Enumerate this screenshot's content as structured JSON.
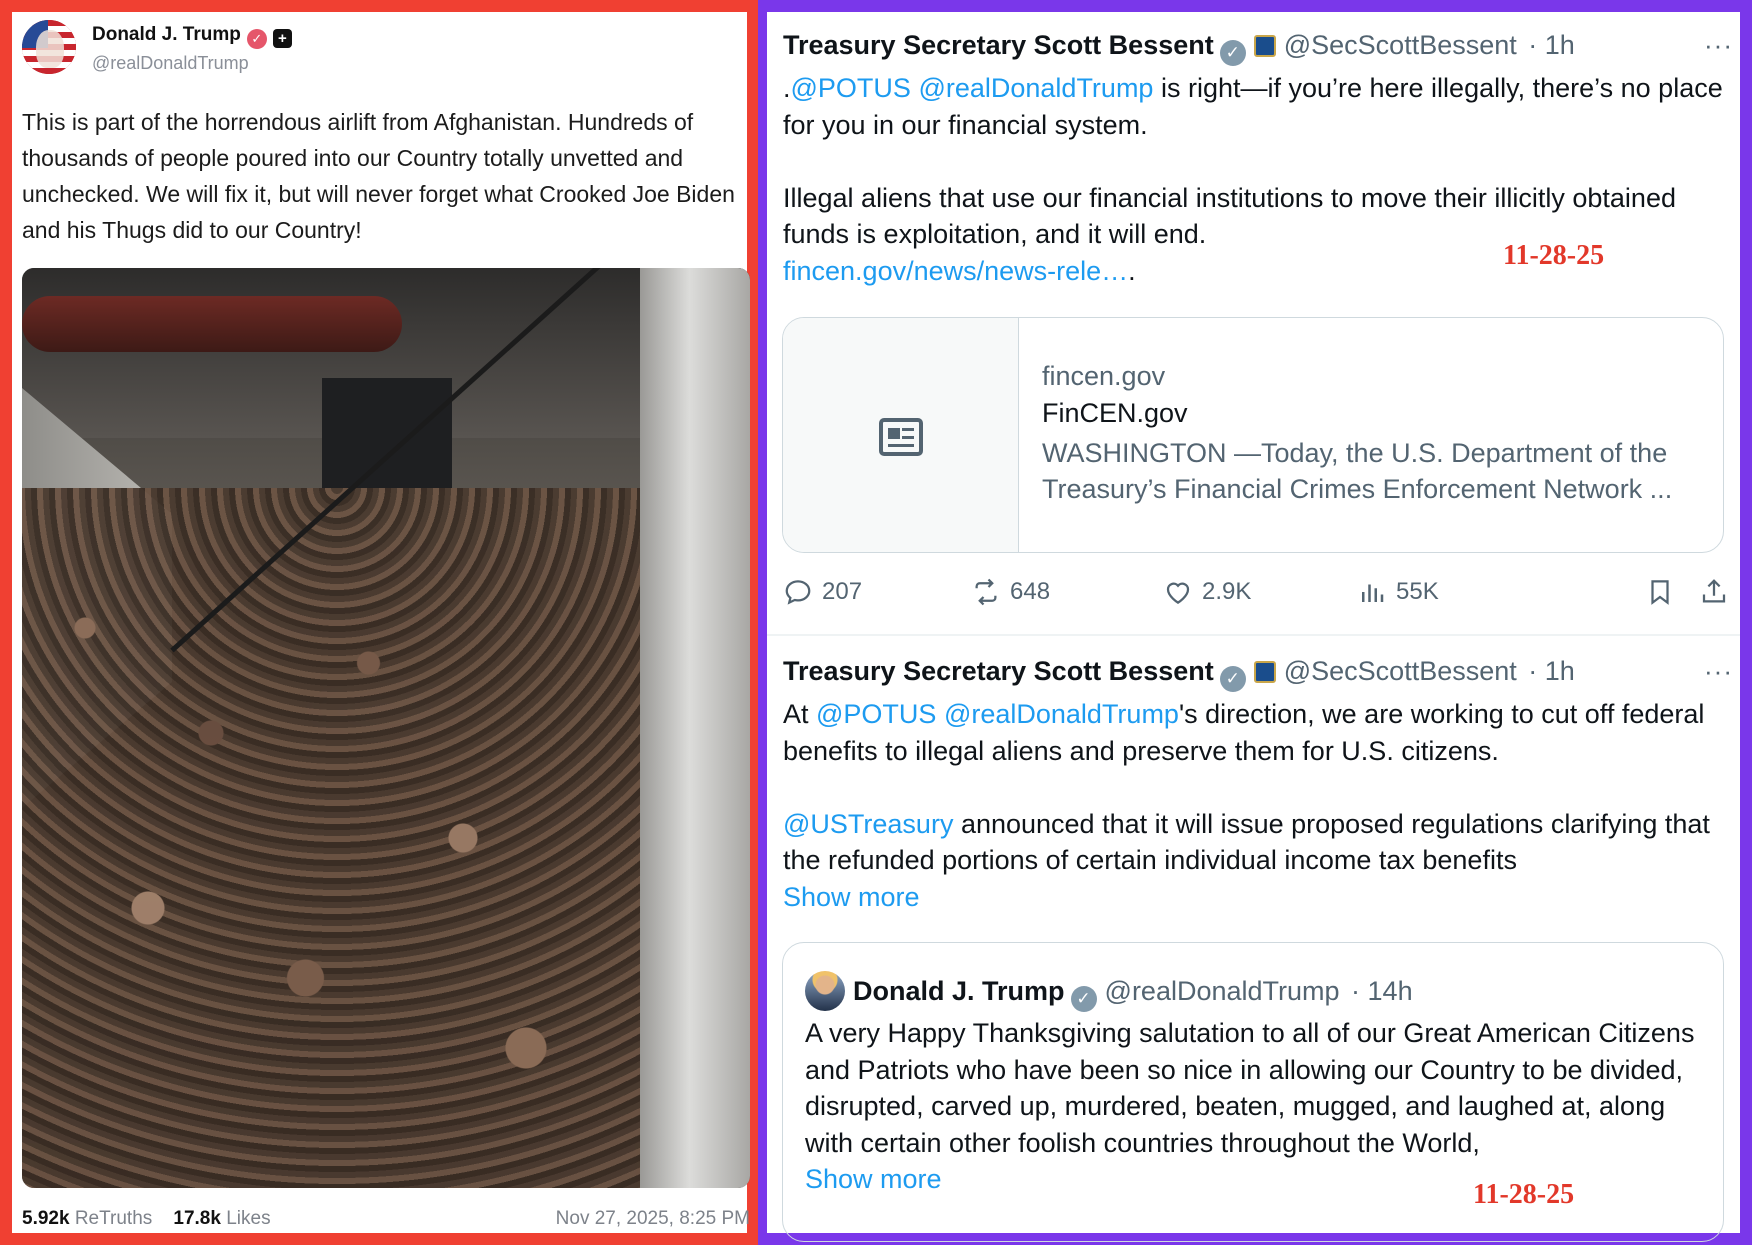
{
  "left": {
    "author_name": "Donald J. Trump",
    "author_handle": "@realDonaldTrump",
    "post_text": "This is part of the horrendous airlift from Afghanistan. Hundreds of thousands of people poured into our Country totally unvetted and unchecked. We will fix it, but will never forget what Crooked Joe Biden and his Thugs did to our Country!",
    "retruths_count": "5.92k",
    "retruths_label": "ReTruths",
    "likes_count": "17.8k",
    "likes_label": "Likes",
    "timestamp": "Nov 27, 2025, 8:25 PM",
    "border_color": "#f04032"
  },
  "right": {
    "border_color": "#7a37ea",
    "tweet1": {
      "author_name": "Treasury Secretary Scott Bessent",
      "author_handle": "@SecScottBessent",
      "time": "· 1h",
      "more": "···",
      "body_pre": ".",
      "mention1": "@POTUS",
      "mention2": "@realDonaldTrump",
      "body_line1": " is right—if you’re here illegally, there’s no place for you in our financial system.",
      "body_para2": "Illegal aliens that use our financial institutions to move their illicitly obtained funds is exploitation, and it will end.",
      "link_text": "fincen.gov/news/news-rele…",
      "link_suffix": ".",
      "stamp": "11-28-25",
      "card": {
        "domain": "fincen.gov",
        "title": "FinCEN.gov",
        "description": "WASHINGTON —Today, the U.S. Department of the Treasury’s Financial Crimes Enforcement Network ..."
      },
      "actions": {
        "replies": "207",
        "reposts": "648",
        "likes": "2.9K",
        "views": "55K"
      }
    },
    "tweet2": {
      "author_name": "Treasury Secretary Scott Bessent",
      "author_handle": "@SecScottBessent",
      "time": "· 1h",
      "more": "···",
      "body_pre": "At ",
      "mention1": "@POTUS",
      "mention2": "@realDonaldTrump",
      "body_line1": "'s direction, we are working to cut off federal benefits to illegal aliens and preserve them for U.S. citizens.",
      "mention3": "@USTreasury",
      "body_para2": " announced that it will issue proposed regulations clarifying that the refunded portions of certain individual income tax benefits",
      "show_more": "Show more",
      "quote": {
        "author_name": "Donald J. Trump",
        "author_handle": "@realDonaldTrump",
        "time": "· 14h",
        "body": "A very Happy Thanksgiving salutation to all of our Great American Citizens and Patriots who have been so nice in allowing our Country to be divided, disrupted, carved up, murdered, beaten, mugged, and laughed at, along with certain other foolish countries throughout the World,",
        "show_more": "Show more",
        "stamp": "11-28-25"
      }
    }
  }
}
